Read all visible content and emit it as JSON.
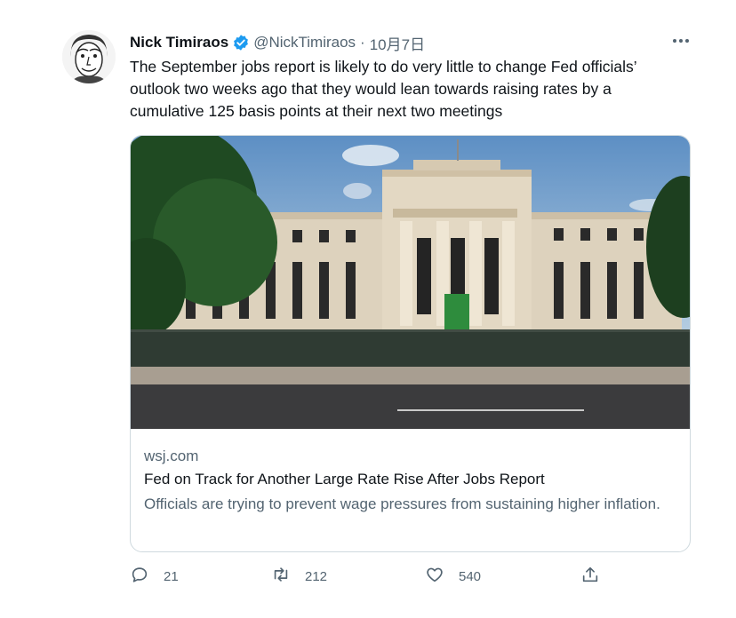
{
  "tweet": {
    "author_name": "Nick Timiraos",
    "handle": "@NickTimiraos",
    "separator": "·",
    "date": "10月7日",
    "text": "The September jobs report is likely to do very little to change Fed officials’ outlook two weeks ago that they would lean towards raising rates by a cumulative 125 basis points at their next two meetings",
    "card": {
      "domain": "wsj.com",
      "headline": "Fed on Track for Another Large Rate Rise After Jobs Report",
      "description": "Officials are trying to prevent wage pressures from sustaining higher inflation."
    },
    "actions": {
      "replies": "21",
      "retweets": "212",
      "likes": "540"
    }
  },
  "colors": {
    "verified": "#1d9bf0",
    "secondary_text": "#536471",
    "primary_text": "#0f1419",
    "border": "#cfd9de"
  },
  "icons": [
    "verified-badge-icon",
    "more-icon",
    "reply-icon",
    "retweet-icon",
    "like-icon",
    "share-icon"
  ]
}
